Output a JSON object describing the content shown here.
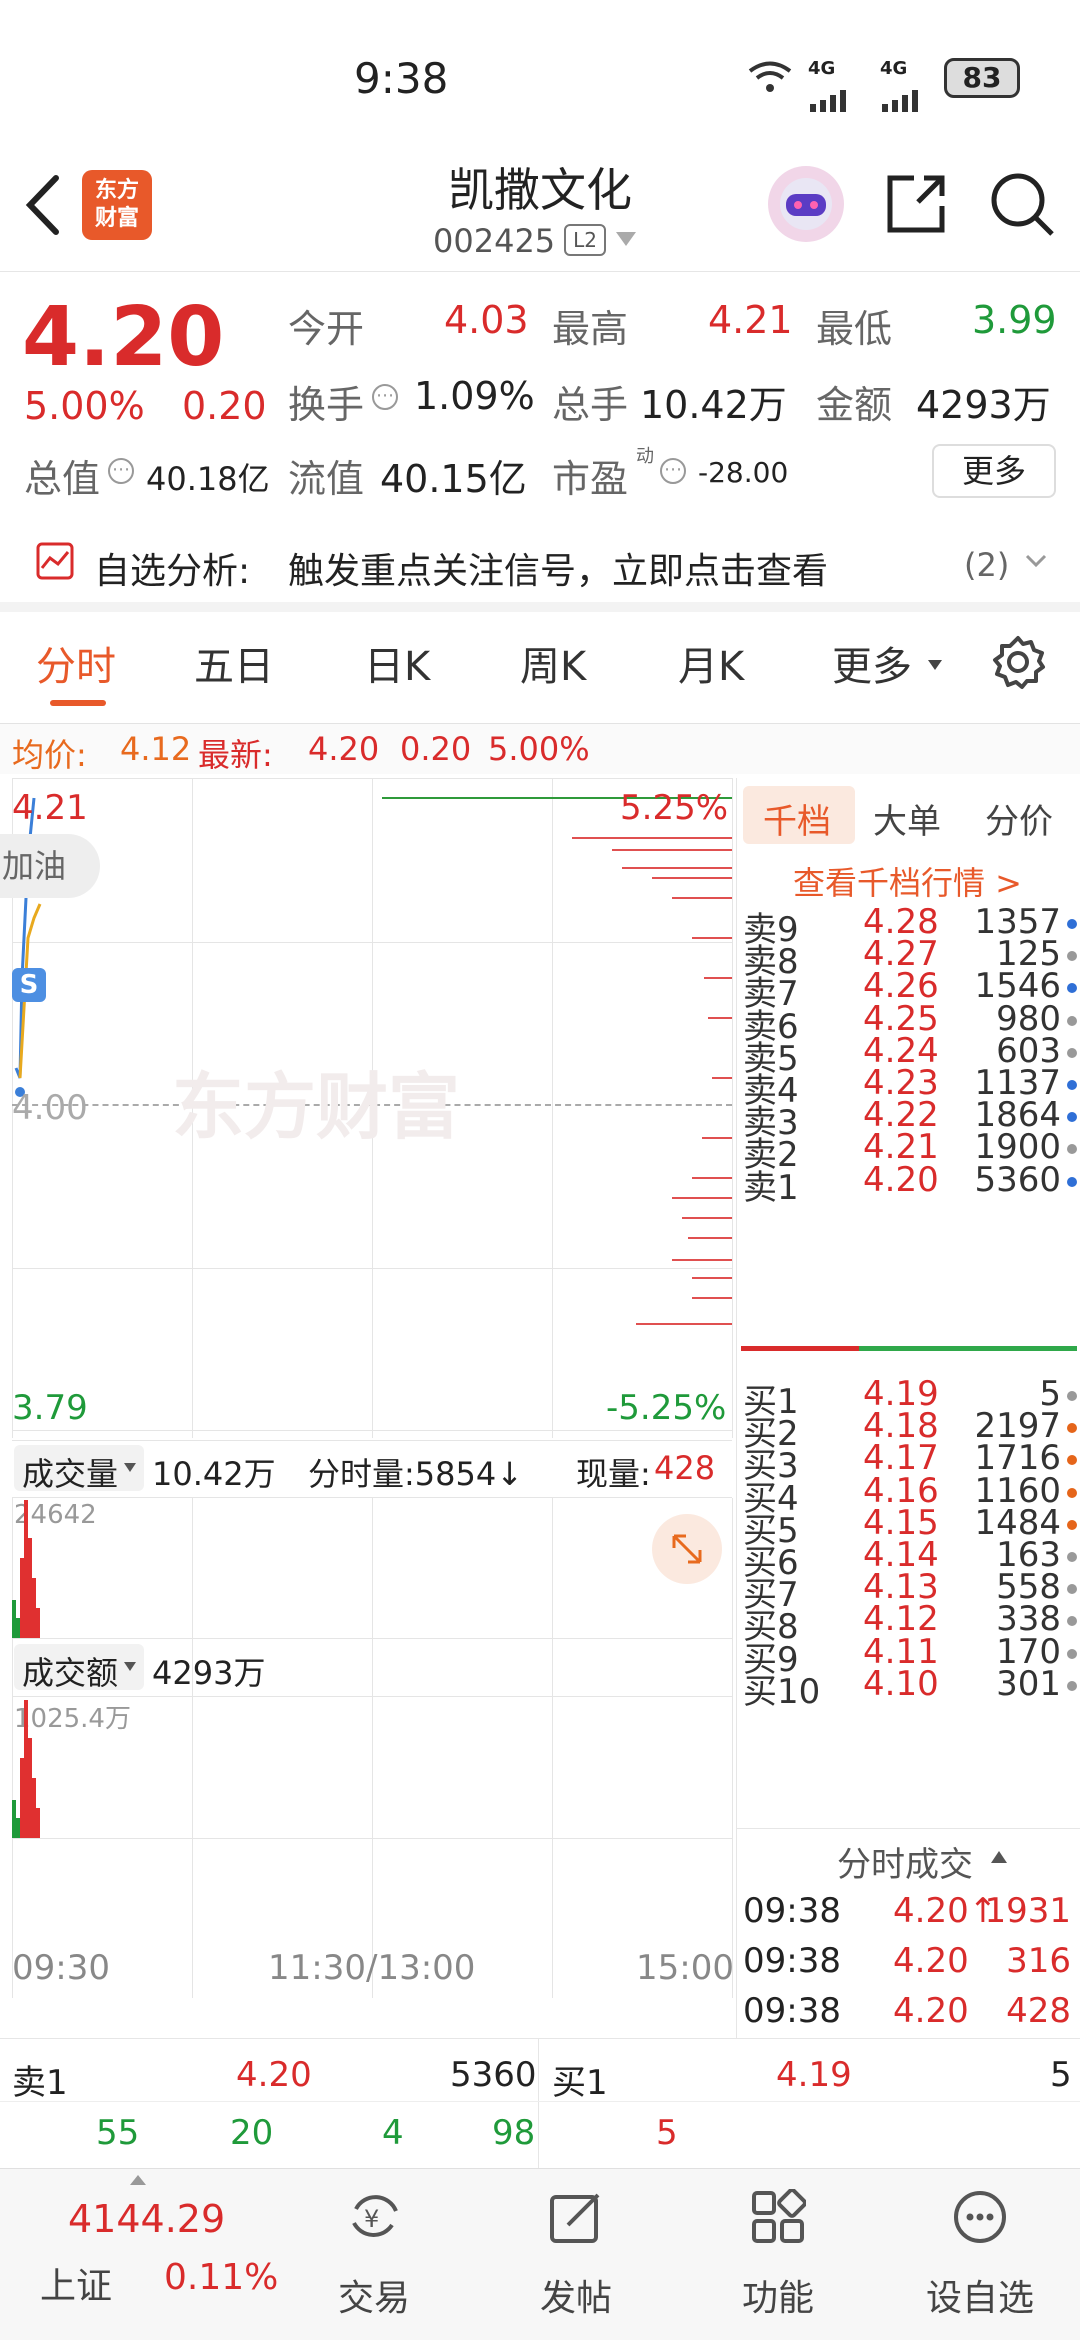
{
  "status": {
    "time": "9:38",
    "net1": "4G",
    "net2": "4G",
    "battery": "83"
  },
  "header": {
    "brand_logo": "东方\n财富",
    "title": "凯撒文化",
    "code": "002425",
    "level": "L2"
  },
  "quote": {
    "price": "4.20",
    "pct": "5.00%",
    "chg": "0.20",
    "open_label": "今开",
    "open": "4.03",
    "high_label": "最高",
    "high": "4.21",
    "low_label": "最低",
    "low": "3.99",
    "turnover_label": "换手",
    "turnover": "1.09%",
    "vol_label": "总手",
    "vol": "10.42万",
    "amt_label": "金额",
    "amt": "4293万",
    "mcap_label": "总值",
    "mcap": "40.18亿",
    "float_label": "流值",
    "float": "40.15亿",
    "pe_label": "市盈",
    "pe_sup": "动",
    "pe": "-28.00",
    "more": "更多"
  },
  "signal": {
    "label": "自选分析:",
    "text": "触发重点关注信号，立即点击查看",
    "count": "(2)"
  },
  "tabs": [
    "分时",
    "五日",
    "日K",
    "周K",
    "月K",
    "更多"
  ],
  "infobar": {
    "avg_label": "均价:",
    "avg": "4.12",
    "last_label": "最新:",
    "last": "4.20",
    "chg": "0.20",
    "pct": "5.00%"
  },
  "chart": {
    "ymax": "4.21",
    "ymid": "4.00",
    "ymin": "3.79",
    "pct_top": "5.25%",
    "pct_bot": "-5.25%",
    "watermark": "东方财富",
    "badge": "S",
    "float_tip": "加油",
    "vol_label": "成交量",
    "vol_total": "10.42万",
    "vol_min_label": "分时量:5854↓",
    "vol_now_label": "现量:",
    "vol_now": "428",
    "vol_peak": "24642",
    "amt_label": "成交额",
    "amt_total": "4293万",
    "amt_peak": "1025.4万",
    "x_start": "09:30",
    "x_mid": "11:30/13:00",
    "x_end": "15:00"
  },
  "orderbook": {
    "tabs": [
      "千档",
      "大单",
      "分价"
    ],
    "link": "查看千档行情 >",
    "asks": [
      {
        "l": "卖9",
        "p": "4.28",
        "v": "1357",
        "c": "#2f6fd6"
      },
      {
        "l": "卖8",
        "p": "4.27",
        "v": "125",
        "c": "#999999"
      },
      {
        "l": "卖7",
        "p": "4.26",
        "v": "1546",
        "c": "#2f6fd6"
      },
      {
        "l": "卖6",
        "p": "4.25",
        "v": "980",
        "c": "#999999"
      },
      {
        "l": "卖5",
        "p": "4.24",
        "v": "603",
        "c": "#999999"
      },
      {
        "l": "卖4",
        "p": "4.23",
        "v": "1137",
        "c": "#2f6fd6"
      },
      {
        "l": "卖3",
        "p": "4.22",
        "v": "1864",
        "c": "#2f6fd6"
      },
      {
        "l": "卖2",
        "p": "4.21",
        "v": "1900",
        "c": "#999999"
      },
      {
        "l": "卖1",
        "p": "4.20",
        "v": "5360",
        "c": "#2f6fd6"
      }
    ],
    "bids": [
      {
        "l": "买1",
        "p": "4.19",
        "v": "5",
        "c": "#999999"
      },
      {
        "l": "买2",
        "p": "4.18",
        "v": "2197",
        "c": "#e5651a"
      },
      {
        "l": "买3",
        "p": "4.17",
        "v": "1716",
        "c": "#e5651a"
      },
      {
        "l": "买4",
        "p": "4.16",
        "v": "1160",
        "c": "#e5651a"
      },
      {
        "l": "买5",
        "p": "4.15",
        "v": "1484",
        "c": "#e5651a"
      },
      {
        "l": "买6",
        "p": "4.14",
        "v": "163",
        "c": "#999999"
      },
      {
        "l": "买7",
        "p": "4.13",
        "v": "558",
        "c": "#999999"
      },
      {
        "l": "买8",
        "p": "4.12",
        "v": "338",
        "c": "#999999"
      },
      {
        "l": "买9",
        "p": "4.11",
        "v": "170",
        "c": "#999999"
      },
      {
        "l": "买10",
        "p": "4.10",
        "v": "301",
        "c": "#999999"
      }
    ],
    "trades_title": "分时成交",
    "trades": [
      {
        "t": "09:38",
        "p": "4.20↑",
        "v": "1931"
      },
      {
        "t": "09:38",
        "p": "4.20",
        "v": "316"
      },
      {
        "t": "09:38",
        "p": "4.20",
        "v": "428"
      }
    ]
  },
  "strip": {
    "ask_label": "卖1",
    "ask_price": "4.20",
    "ask_vol": "5360",
    "bid_label": "买1",
    "bid_price": "4.19",
    "bid_vol": "5",
    "q1": "55",
    "q2": "20",
    "q3": "4",
    "q4": "98",
    "q5": "5"
  },
  "nav": {
    "index_value": "4144.29",
    "index_name": "上证",
    "index_pct": "0.11%",
    "items": [
      "交易",
      "发帖",
      "功能",
      "设自选"
    ]
  },
  "colors": {
    "red": "#d92b2b",
    "green": "#1f9a3a",
    "orange": "#e86a1e",
    "blue": "#2f6fd6"
  }
}
